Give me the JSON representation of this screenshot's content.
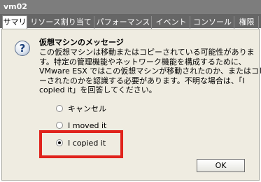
{
  "window": {
    "title": "vm02"
  },
  "tabs": [
    {
      "label": "サマリ",
      "active": true
    },
    {
      "label": "リソース割り当て",
      "active": false
    },
    {
      "label": "パフォーマンス",
      "active": false
    },
    {
      "label": "イベント",
      "active": false
    },
    {
      "label": "コンソール",
      "active": false
    },
    {
      "label": "権限",
      "active": false
    }
  ],
  "dialog": {
    "icon": "question-icon",
    "heading": "仮想マシンのメッセージ",
    "message_lines": [
      "この仮想マシンは移動またはコピーされている可能性がありま",
      "す。特定の管理機能やネットワーク機能を構成するために、",
      "VMware ESX ではこの仮想マシンが移動されたのか、またはコピ",
      "ーされたのかを認識する必要があります。不明な場合は、「I",
      "copied it」を回答してください。"
    ],
    "options": [
      {
        "label": "キャンセル",
        "selected": false
      },
      {
        "label": "I moved it",
        "selected": false
      },
      {
        "label": "I copied it",
        "selected": true
      }
    ],
    "ok_label": "OK"
  },
  "colors": {
    "titlebar": "#7d7d7d",
    "tabbar": "#666666",
    "panel": "#efece1",
    "highlight": "#e0231c"
  }
}
